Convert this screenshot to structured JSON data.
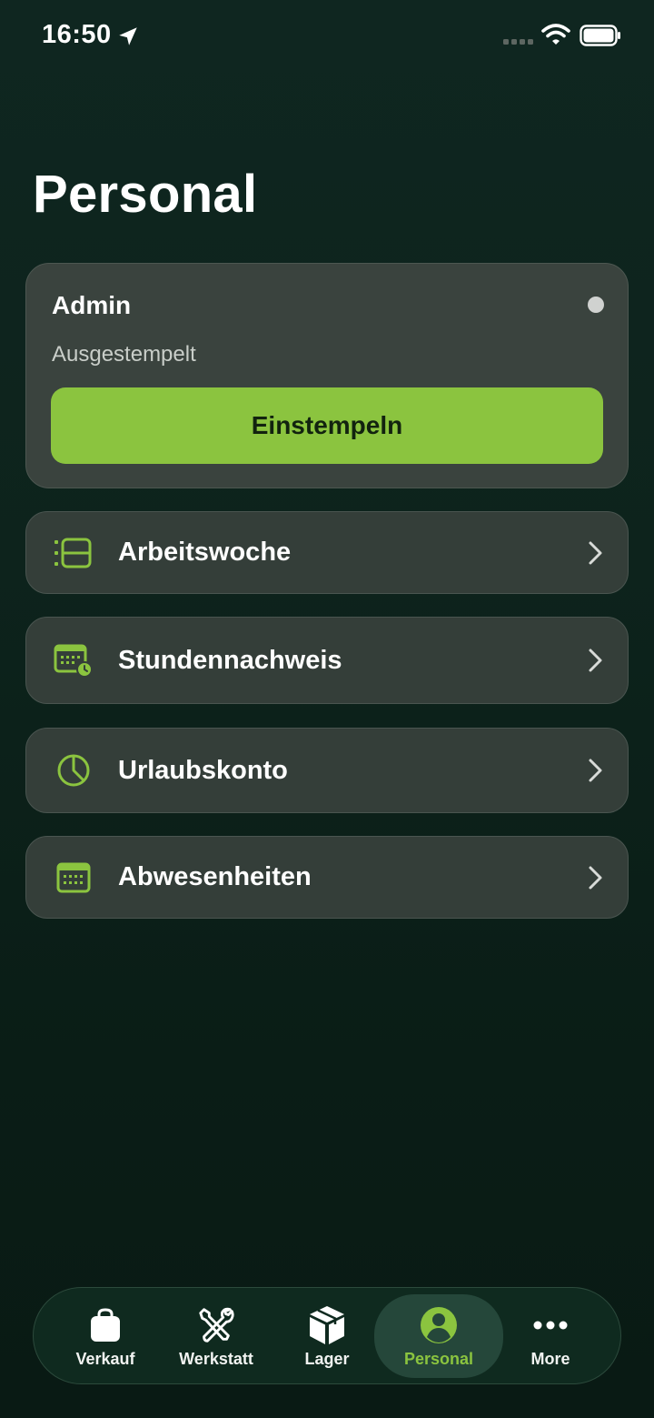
{
  "status_bar": {
    "time": "16:50"
  },
  "page": {
    "title": "Personal"
  },
  "user_card": {
    "name": "Admin",
    "status": "Ausgestempelt",
    "button_label": "Einstempeln"
  },
  "menu": {
    "items": [
      {
        "label": "Arbeitswoche",
        "icon": "schedule-list-icon"
      },
      {
        "label": "Stundennachweis",
        "icon": "calendar-clock-icon"
      },
      {
        "label": "Urlaubskonto",
        "icon": "pie-chart-icon"
      },
      {
        "label": "Abwesenheiten",
        "icon": "calendar-icon"
      }
    ]
  },
  "tab_bar": {
    "active": "Personal",
    "tabs": [
      {
        "label": "Verkauf",
        "icon": "shopping-bag-icon"
      },
      {
        "label": "Werkstatt",
        "icon": "tools-icon"
      },
      {
        "label": "Lager",
        "icon": "box-icon"
      },
      {
        "label": "Personal",
        "icon": "person-icon"
      },
      {
        "label": "More",
        "icon": "more-dots-icon"
      }
    ]
  },
  "colors": {
    "accent": "#8bc43f",
    "background": "#0d231c",
    "card": "#3a433e",
    "row": "#343e39"
  }
}
